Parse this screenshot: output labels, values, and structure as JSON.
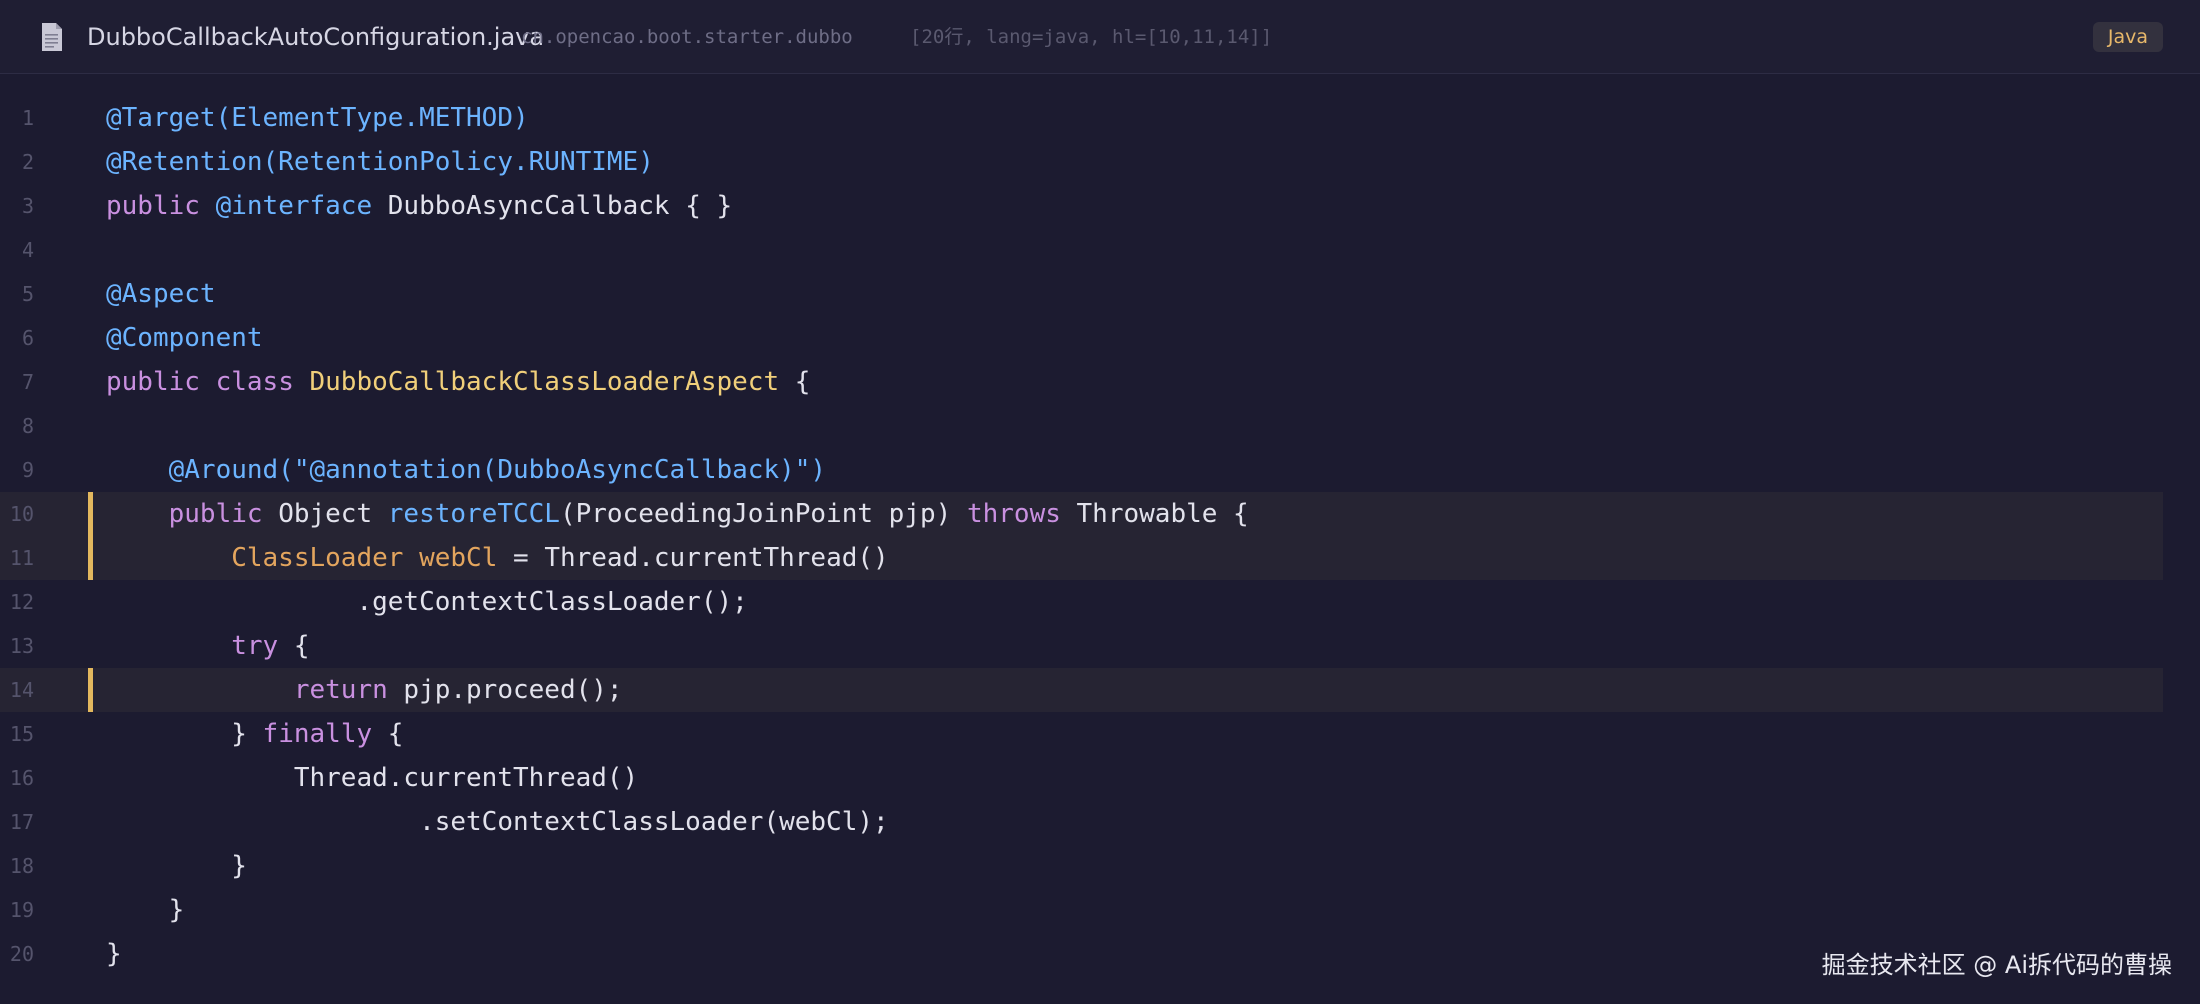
{
  "header": {
    "file_name": "DubboCallbackAutoConfiguration.java",
    "package": "cn.opencao.boot.starter.dubbo",
    "meta": "[20行, lang=java, hl=[10,11,14]]",
    "language": "Java"
  },
  "colors": {
    "background": "#1c1b30",
    "keyword": "#c990e0",
    "annotation": "#6cb4ff",
    "type": "#f0cf7a",
    "variable": "#e3a55e",
    "highlight_bar": "#e3b85e"
  },
  "lines": [
    {
      "n": "1",
      "hl": false,
      "tokens": [
        {
          "t": "@Target(ElementType.METHOD)",
          "c": "ann"
        }
      ]
    },
    {
      "n": "2",
      "hl": false,
      "tokens": [
        {
          "t": "@Retention(RetentionPolicy.RUNTIME)",
          "c": "ann"
        }
      ]
    },
    {
      "n": "3",
      "hl": false,
      "tokens": [
        {
          "t": "public ",
          "c": "kw"
        },
        {
          "t": "@interface",
          "c": "ann"
        },
        {
          "t": " DubboAsyncCallback { }",
          "c": "plain"
        }
      ]
    },
    {
      "n": "4",
      "hl": false,
      "tokens": []
    },
    {
      "n": "5",
      "hl": false,
      "tokens": [
        {
          "t": "@Aspect",
          "c": "ann"
        }
      ]
    },
    {
      "n": "6",
      "hl": false,
      "tokens": [
        {
          "t": "@Component",
          "c": "ann"
        }
      ]
    },
    {
      "n": "7",
      "hl": false,
      "tokens": [
        {
          "t": "public ",
          "c": "kw"
        },
        {
          "t": "class ",
          "c": "kw"
        },
        {
          "t": "DubboCallbackClassLoaderAspect",
          "c": "type"
        },
        {
          "t": " {",
          "c": "plain"
        }
      ]
    },
    {
      "n": "8",
      "hl": false,
      "tokens": []
    },
    {
      "n": "9",
      "hl": false,
      "tokens": [
        {
          "t": "    @Around(\"@annotation(DubboAsyncCallback)\")",
          "c": "ann"
        }
      ]
    },
    {
      "n": "10",
      "hl": true,
      "tokens": [
        {
          "t": "    public ",
          "c": "kw"
        },
        {
          "t": "Object ",
          "c": "plain"
        },
        {
          "t": "restoreTCCL",
          "c": "fn"
        },
        {
          "t": "(ProceedingJoinPoint pjp) ",
          "c": "plain"
        },
        {
          "t": "throws",
          "c": "kw"
        },
        {
          "t": " Throwable {",
          "c": "plain"
        }
      ]
    },
    {
      "n": "11",
      "hl": true,
      "tokens": [
        {
          "t": "        ClassLoader ",
          "c": "var"
        },
        {
          "t": "webCl",
          "c": "var"
        },
        {
          "t": " = Thread.currentThread()",
          "c": "plain"
        }
      ]
    },
    {
      "n": "12",
      "hl": false,
      "tokens": [
        {
          "t": "                .getContextClassLoader();",
          "c": "plain"
        }
      ]
    },
    {
      "n": "13",
      "hl": false,
      "tokens": [
        {
          "t": "        try",
          "c": "kw"
        },
        {
          "t": " {",
          "c": "plain"
        }
      ]
    },
    {
      "n": "14",
      "hl": true,
      "tokens": [
        {
          "t": "            return",
          "c": "kw"
        },
        {
          "t": " pjp.proceed();",
          "c": "plain"
        }
      ]
    },
    {
      "n": "15",
      "hl": false,
      "tokens": [
        {
          "t": "        } ",
          "c": "plain"
        },
        {
          "t": "finally",
          "c": "kw"
        },
        {
          "t": " {",
          "c": "plain"
        }
      ]
    },
    {
      "n": "16",
      "hl": false,
      "tokens": [
        {
          "t": "            Thread.currentThread()",
          "c": "plain"
        }
      ]
    },
    {
      "n": "17",
      "hl": false,
      "tokens": [
        {
          "t": "                    .setContextClassLoader(webCl);",
          "c": "plain"
        }
      ]
    },
    {
      "n": "18",
      "hl": false,
      "tokens": [
        {
          "t": "        }",
          "c": "plain"
        }
      ]
    },
    {
      "n": "19",
      "hl": false,
      "tokens": [
        {
          "t": "    }",
          "c": "plain"
        }
      ]
    },
    {
      "n": "20",
      "hl": false,
      "tokens": [
        {
          "t": "}",
          "c": "plain"
        }
      ]
    }
  ],
  "watermark": "掘金技术社区 @ Ai拆代码的曹操"
}
